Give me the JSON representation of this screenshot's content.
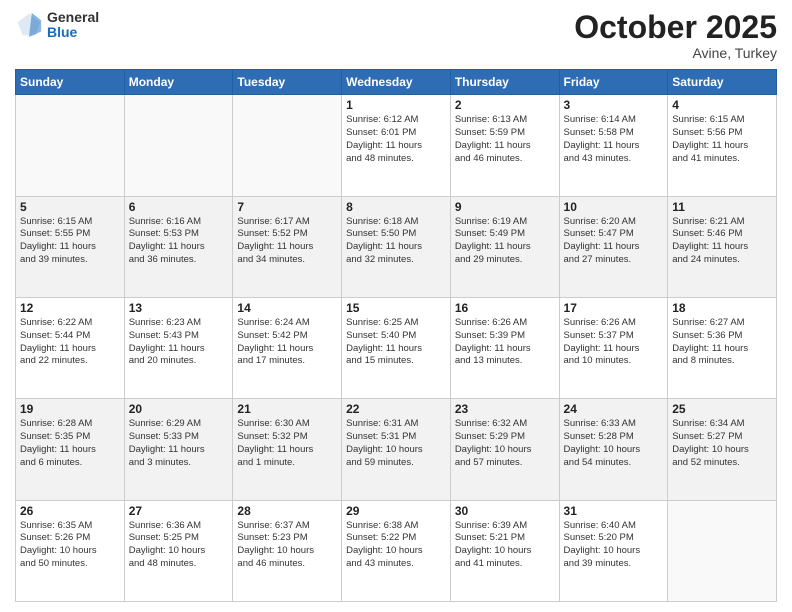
{
  "header": {
    "logo_general": "General",
    "logo_blue": "Blue",
    "month_title": "October 2025",
    "subtitle": "Avine, Turkey"
  },
  "days_of_week": [
    "Sunday",
    "Monday",
    "Tuesday",
    "Wednesday",
    "Thursday",
    "Friday",
    "Saturday"
  ],
  "weeks": [
    [
      {
        "day": "",
        "info": ""
      },
      {
        "day": "",
        "info": ""
      },
      {
        "day": "",
        "info": ""
      },
      {
        "day": "1",
        "info": "Sunrise: 6:12 AM\nSunset: 6:01 PM\nDaylight: 11 hours\nand 48 minutes."
      },
      {
        "day": "2",
        "info": "Sunrise: 6:13 AM\nSunset: 5:59 PM\nDaylight: 11 hours\nand 46 minutes."
      },
      {
        "day": "3",
        "info": "Sunrise: 6:14 AM\nSunset: 5:58 PM\nDaylight: 11 hours\nand 43 minutes."
      },
      {
        "day": "4",
        "info": "Sunrise: 6:15 AM\nSunset: 5:56 PM\nDaylight: 11 hours\nand 41 minutes."
      }
    ],
    [
      {
        "day": "5",
        "info": "Sunrise: 6:15 AM\nSunset: 5:55 PM\nDaylight: 11 hours\nand 39 minutes."
      },
      {
        "day": "6",
        "info": "Sunrise: 6:16 AM\nSunset: 5:53 PM\nDaylight: 11 hours\nand 36 minutes."
      },
      {
        "day": "7",
        "info": "Sunrise: 6:17 AM\nSunset: 5:52 PM\nDaylight: 11 hours\nand 34 minutes."
      },
      {
        "day": "8",
        "info": "Sunrise: 6:18 AM\nSunset: 5:50 PM\nDaylight: 11 hours\nand 32 minutes."
      },
      {
        "day": "9",
        "info": "Sunrise: 6:19 AM\nSunset: 5:49 PM\nDaylight: 11 hours\nand 29 minutes."
      },
      {
        "day": "10",
        "info": "Sunrise: 6:20 AM\nSunset: 5:47 PM\nDaylight: 11 hours\nand 27 minutes."
      },
      {
        "day": "11",
        "info": "Sunrise: 6:21 AM\nSunset: 5:46 PM\nDaylight: 11 hours\nand 24 minutes."
      }
    ],
    [
      {
        "day": "12",
        "info": "Sunrise: 6:22 AM\nSunset: 5:44 PM\nDaylight: 11 hours\nand 22 minutes."
      },
      {
        "day": "13",
        "info": "Sunrise: 6:23 AM\nSunset: 5:43 PM\nDaylight: 11 hours\nand 20 minutes."
      },
      {
        "day": "14",
        "info": "Sunrise: 6:24 AM\nSunset: 5:42 PM\nDaylight: 11 hours\nand 17 minutes."
      },
      {
        "day": "15",
        "info": "Sunrise: 6:25 AM\nSunset: 5:40 PM\nDaylight: 11 hours\nand 15 minutes."
      },
      {
        "day": "16",
        "info": "Sunrise: 6:26 AM\nSunset: 5:39 PM\nDaylight: 11 hours\nand 13 minutes."
      },
      {
        "day": "17",
        "info": "Sunrise: 6:26 AM\nSunset: 5:37 PM\nDaylight: 11 hours\nand 10 minutes."
      },
      {
        "day": "18",
        "info": "Sunrise: 6:27 AM\nSunset: 5:36 PM\nDaylight: 11 hours\nand 8 minutes."
      }
    ],
    [
      {
        "day": "19",
        "info": "Sunrise: 6:28 AM\nSunset: 5:35 PM\nDaylight: 11 hours\nand 6 minutes."
      },
      {
        "day": "20",
        "info": "Sunrise: 6:29 AM\nSunset: 5:33 PM\nDaylight: 11 hours\nand 3 minutes."
      },
      {
        "day": "21",
        "info": "Sunrise: 6:30 AM\nSunset: 5:32 PM\nDaylight: 11 hours\nand 1 minute."
      },
      {
        "day": "22",
        "info": "Sunrise: 6:31 AM\nSunset: 5:31 PM\nDaylight: 10 hours\nand 59 minutes."
      },
      {
        "day": "23",
        "info": "Sunrise: 6:32 AM\nSunset: 5:29 PM\nDaylight: 10 hours\nand 57 minutes."
      },
      {
        "day": "24",
        "info": "Sunrise: 6:33 AM\nSunset: 5:28 PM\nDaylight: 10 hours\nand 54 minutes."
      },
      {
        "day": "25",
        "info": "Sunrise: 6:34 AM\nSunset: 5:27 PM\nDaylight: 10 hours\nand 52 minutes."
      }
    ],
    [
      {
        "day": "26",
        "info": "Sunrise: 6:35 AM\nSunset: 5:26 PM\nDaylight: 10 hours\nand 50 minutes."
      },
      {
        "day": "27",
        "info": "Sunrise: 6:36 AM\nSunset: 5:25 PM\nDaylight: 10 hours\nand 48 minutes."
      },
      {
        "day": "28",
        "info": "Sunrise: 6:37 AM\nSunset: 5:23 PM\nDaylight: 10 hours\nand 46 minutes."
      },
      {
        "day": "29",
        "info": "Sunrise: 6:38 AM\nSunset: 5:22 PM\nDaylight: 10 hours\nand 43 minutes."
      },
      {
        "day": "30",
        "info": "Sunrise: 6:39 AM\nSunset: 5:21 PM\nDaylight: 10 hours\nand 41 minutes."
      },
      {
        "day": "31",
        "info": "Sunrise: 6:40 AM\nSunset: 5:20 PM\nDaylight: 10 hours\nand 39 minutes."
      },
      {
        "day": "",
        "info": ""
      }
    ]
  ]
}
